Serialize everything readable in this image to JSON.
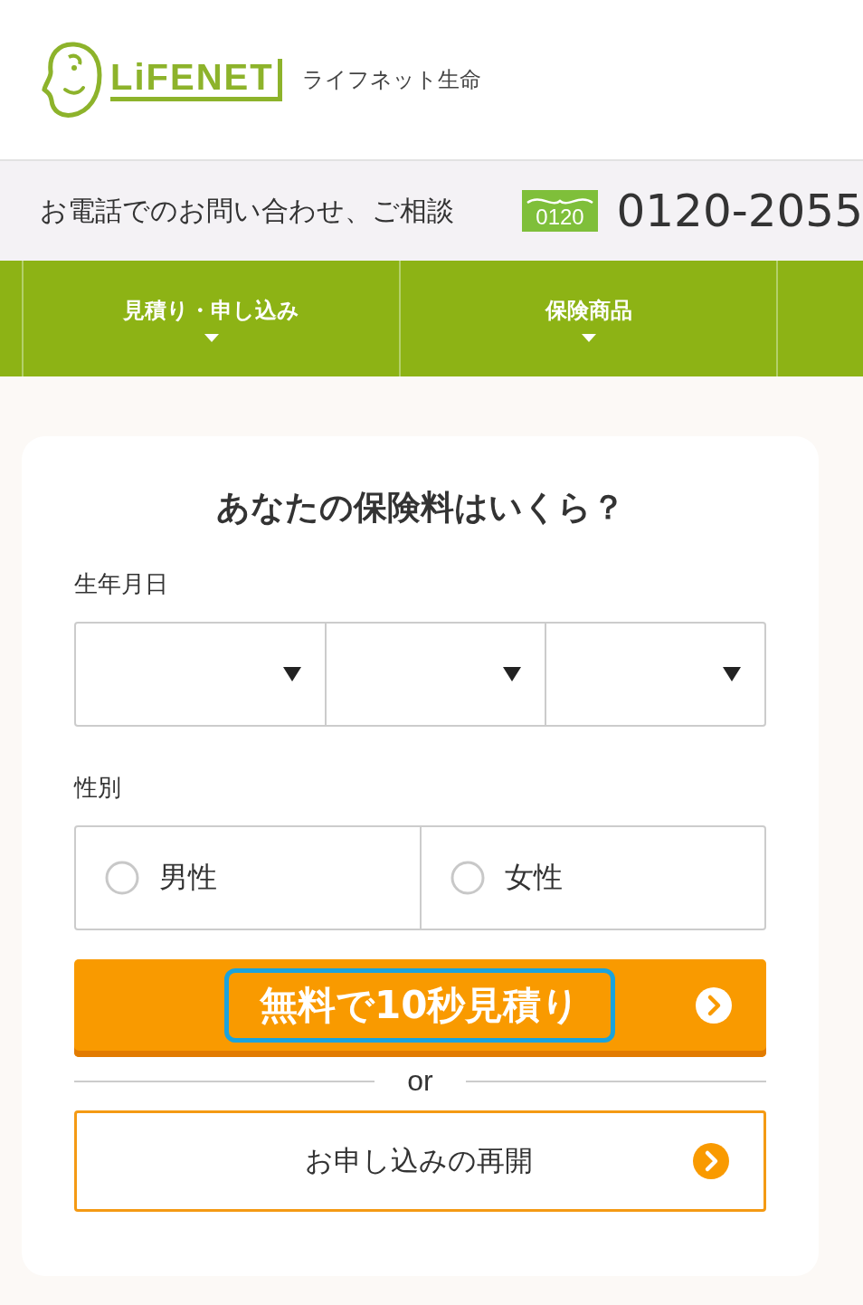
{
  "header": {
    "logo_text": "LiFENET",
    "company": "ライフネット生命"
  },
  "contact_bar": {
    "label": "お電話でのお問い合わせ、ご相談",
    "badge": "0120",
    "phone": "0120-2055"
  },
  "nav": [
    {
      "kind": "menu",
      "label": "見積り・申し込み",
      "expanded": false
    },
    {
      "kind": "menu",
      "label": "保険商品",
      "expanded": false
    },
    {
      "kind": "blank"
    }
  ],
  "form": {
    "title": "あなたの保険料はいくら？",
    "birthdate": {
      "label": "生年月日",
      "selects": [
        {
          "kind": "dropdown"
        },
        {
          "kind": "dropdown"
        },
        {
          "kind": "dropdown"
        }
      ]
    },
    "gender": {
      "label": "性別",
      "options": [
        {
          "label": "男性",
          "selected": false
        },
        {
          "label": "女性",
          "selected": false
        }
      ]
    },
    "quote_button": {
      "label": "無料で10秒見積り",
      "focused": true
    },
    "separator": "or",
    "resume_button": {
      "label": "お申し込みの再開"
    }
  }
}
